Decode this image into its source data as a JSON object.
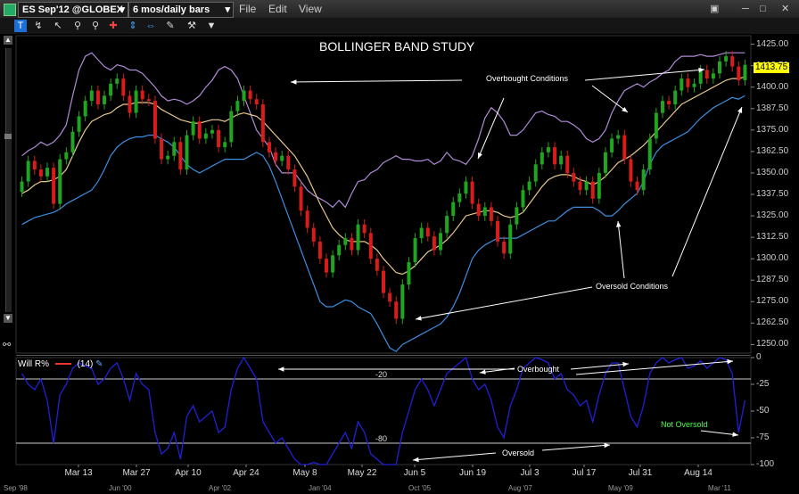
{
  "toolbar": {
    "symbol": "ES Sep'12 @GLOBEX",
    "period": "6 mos/daily bars",
    "menus": [
      "File",
      "Edit",
      "View"
    ]
  },
  "chart": {
    "title": "BOLLINGER BAND STUDY",
    "price_ticks": [
      "1425.00",
      "1412.50",
      "1400.00",
      "1387.50",
      "1375.00",
      "1362.50",
      "1350.00",
      "1337.50",
      "1325.00",
      "1312.50",
      "1300.00",
      "1287.50",
      "1275.00",
      "1262.50",
      "1250.00"
    ],
    "last_price": "1413.75",
    "x_labels": [
      "Mar 13",
      "Mar 27",
      "Apr 10",
      "Apr 24",
      "May 8",
      "May 22",
      "Jun 5",
      "Jun 19",
      "Jul 3",
      "Jul 17",
      "Jul 31",
      "Aug 14"
    ],
    "year_labels": [
      "Sep '98",
      "Jun '00",
      "Apr '02",
      "Jan '04",
      "Oct '05",
      "Aug '07",
      "May '09",
      "Mar '11"
    ],
    "annotations": {
      "overbought_conditions": "Overbought Conditions",
      "oversold_conditions": "Oversold Conditions",
      "overbought": "Overbought",
      "oversold": "Oversold",
      "not_oversold": "Not Oversold"
    }
  },
  "indicator": {
    "name": "Will R%",
    "param": "(14)",
    "ticks": [
      "0",
      "-25",
      "-50",
      "-75",
      "-100"
    ],
    "level_high": "-20",
    "level_low": "-80"
  },
  "colors": {
    "up": "#1fa51f",
    "down": "#d81c1c",
    "upper_band": "#b08bd8",
    "lower_band": "#3b8fe0",
    "middle_band": "#e8c88a",
    "willr": "#2020d8",
    "last_price_bg": "#ffff00"
  },
  "chart_data": {
    "type": "candlestick",
    "ylim": [
      1245,
      1430
    ],
    "close": [
      1345,
      1357,
      1352,
      1348,
      1353,
      1332,
      1358,
      1362,
      1374,
      1383,
      1392,
      1398,
      1390,
      1395,
      1402,
      1405,
      1395,
      1385,
      1398,
      1393,
      1392,
      1370,
      1358,
      1360,
      1368,
      1352,
      1372,
      1380,
      1370,
      1373,
      1375,
      1365,
      1368,
      1386,
      1392,
      1398,
      1393,
      1390,
      1368,
      1362,
      1357,
      1360,
      1352,
      1342,
      1328,
      1318,
      1310,
      1300,
      1292,
      1302,
      1308,
      1312,
      1305,
      1320,
      1315,
      1300,
      1293,
      1280,
      1275,
      1265,
      1285,
      1298,
      1312,
      1318,
      1313,
      1305,
      1315,
      1325,
      1333,
      1338,
      1345,
      1332,
      1325,
      1330,
      1322,
      1310,
      1303,
      1320,
      1330,
      1340,
      1345,
      1355,
      1362,
      1365,
      1355,
      1360,
      1350,
      1345,
      1340,
      1345,
      1335,
      1350,
      1362,
      1370,
      1372,
      1358,
      1345,
      1340,
      1352,
      1370,
      1385,
      1392,
      1390,
      1398,
      1405,
      1400,
      1402,
      1410,
      1405,
      1408,
      1415,
      1418,
      1412,
      1404,
      1413
    ],
    "upper_band": [
      1360,
      1363,
      1365,
      1368,
      1366,
      1368,
      1372,
      1378,
      1395,
      1410,
      1418,
      1420,
      1416,
      1412,
      1410,
      1413,
      1412,
      1410,
      1410,
      1408,
      1404,
      1400,
      1395,
      1392,
      1393,
      1392,
      1390,
      1392,
      1395,
      1400,
      1404,
      1410,
      1412,
      1410,
      1405,
      1395,
      1385,
      1375,
      1370,
      1365,
      1355,
      1350,
      1350,
      1350,
      1345,
      1340,
      1337,
      1335,
      1333,
      1330,
      1334,
      1330,
      1338,
      1345,
      1346,
      1350,
      1352,
      1356,
      1358,
      1360,
      1358,
      1358,
      1357,
      1357,
      1358,
      1355,
      1357,
      1362,
      1358,
      1357,
      1355,
      1360,
      1370,
      1382,
      1388,
      1385,
      1380,
      1372,
      1372,
      1375,
      1380,
      1385,
      1386,
      1384,
      1383,
      1380,
      1380,
      1378,
      1375,
      1370,
      1368,
      1370,
      1375,
      1385,
      1392,
      1398,
      1400,
      1402,
      1400,
      1403,
      1405,
      1408,
      1410,
      1415,
      1418,
      1418,
      1418,
      1419,
      1418,
      1418,
      1419,
      1420,
      1420,
      1420,
      1420
    ],
    "middle_band": [
      1338,
      1340,
      1343,
      1345,
      1345,
      1346,
      1348,
      1352,
      1360,
      1368,
      1375,
      1380,
      1382,
      1384,
      1385,
      1388,
      1390,
      1390,
      1391,
      1391,
      1391,
      1390,
      1387,
      1385,
      1383,
      1381,
      1380,
      1379,
      1379,
      1380,
      1381,
      1381,
      1380,
      1382,
      1384,
      1385,
      1384,
      1383,
      1380,
      1376,
      1372,
      1368,
      1364,
      1360,
      1354,
      1348,
      1340,
      1332,
      1325,
      1318,
      1314,
      1311,
      1310,
      1310,
      1310,
      1308,
      1305,
      1300,
      1296,
      1292,
      1291,
      1293,
      1296,
      1300,
      1304,
      1306,
      1308,
      1311,
      1315,
      1320,
      1325,
      1326,
      1327,
      1328,
      1328,
      1327,
      1325,
      1324,
      1325,
      1327,
      1332,
      1337,
      1342,
      1346,
      1348,
      1349,
      1349,
      1348,
      1346,
      1345,
      1343,
      1345,
      1348,
      1352,
      1356,
      1358,
      1360,
      1363,
      1366,
      1370,
      1374,
      1378,
      1382,
      1386,
      1390,
      1392,
      1394,
      1396,
      1398,
      1400,
      1402,
      1404,
      1405,
      1405,
      1406
    ],
    "lower_band": [
      1320,
      1322,
      1324,
      1325,
      1326,
      1327,
      1329,
      1332,
      1334,
      1336,
      1338,
      1340,
      1345,
      1352,
      1360,
      1365,
      1368,
      1370,
      1371,
      1371,
      1372,
      1372,
      1370,
      1368,
      1365,
      1360,
      1355,
      1352,
      1350,
      1352,
      1354,
      1356,
      1358,
      1358,
      1358,
      1358,
      1360,
      1362,
      1360,
      1354,
      1345,
      1335,
      1325,
      1315,
      1305,
      1295,
      1285,
      1275,
      1272,
      1272,
      1274,
      1276,
      1275,
      1272,
      1270,
      1268,
      1262,
      1255,
      1248,
      1246,
      1250,
      1252,
      1254,
      1256,
      1258,
      1260,
      1262,
      1266,
      1272,
      1280,
      1290,
      1300,
      1305,
      1308,
      1310,
      1312,
      1312,
      1312,
      1312,
      1314,
      1316,
      1318,
      1320,
      1322,
      1322,
      1325,
      1328,
      1330,
      1330,
      1330,
      1330,
      1328,
      1325,
      1325,
      1328,
      1332,
      1335,
      1338,
      1345,
      1355,
      1362,
      1366,
      1368,
      1370,
      1372,
      1374,
      1378,
      1382,
      1385,
      1388,
      1390,
      1392,
      1394,
      1393,
      1395
    ],
    "willr": [
      -15,
      -25,
      -30,
      -20,
      -40,
      -80,
      -35,
      -25,
      -10,
      -5,
      -8,
      -10,
      -25,
      -20,
      -10,
      -5,
      -20,
      -40,
      -15,
      -25,
      -30,
      -70,
      -90,
      -85,
      -70,
      -95,
      -55,
      -45,
      -60,
      -55,
      -50,
      -70,
      -65,
      -30,
      -10,
      0,
      -10,
      -20,
      -60,
      -70,
      -80,
      -75,
      -85,
      -95,
      -100,
      -100,
      -98,
      -100,
      -100,
      -90,
      -80,
      -70,
      -85,
      -60,
      -70,
      -90,
      -95,
      -100,
      -100,
      -100,
      -70,
      -50,
      -30,
      -20,
      -30,
      -45,
      -30,
      -15,
      -10,
      -5,
      0,
      -20,
      -30,
      -25,
      -40,
      -65,
      -75,
      -45,
      -30,
      -10,
      -5,
      0,
      -2,
      -5,
      -20,
      -15,
      -30,
      -35,
      -45,
      -40,
      -60,
      -35,
      -15,
      -5,
      -5,
      -30,
      -55,
      -65,
      -45,
      -15,
      -5,
      0,
      -5,
      -2,
      0,
      -10,
      -8,
      -3,
      -10,
      -5,
      0,
      -2,
      -15,
      -70,
      -40
    ]
  }
}
